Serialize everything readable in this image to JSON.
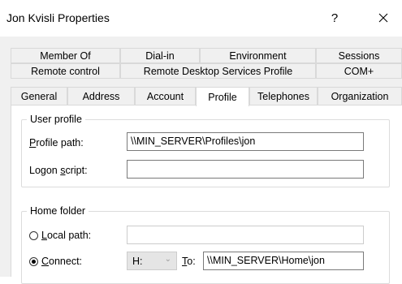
{
  "window": {
    "title": "Jon Kvisli Properties",
    "help_symbol": "?",
    "close_icon": "close-icon"
  },
  "tabs": {
    "row1": [
      "Member Of",
      "Dial-in",
      "Environment",
      "Sessions"
    ],
    "row2": [
      "Remote control",
      "Remote Desktop Services Profile",
      "COM+"
    ],
    "row3": [
      "General",
      "Address",
      "Account",
      "Profile",
      "Telephones",
      "Organization"
    ],
    "active": "Profile"
  },
  "user_profile": {
    "group_label": "User profile",
    "profile_path_label_accel": "P",
    "profile_path_label_rest": "rofile path:",
    "profile_path_value": "\\\\MIN_SERVER\\Profiles\\jon",
    "logon_script_label_pre": "Logon ",
    "logon_script_label_accel": "s",
    "logon_script_label_post": "cript:",
    "logon_script_value": ""
  },
  "home_folder": {
    "group_label": "Home folder",
    "local_path_label_accel": "L",
    "local_path_label_rest": "ocal path:",
    "local_path_value": "",
    "local_path_selected": false,
    "connect_label_accel": "C",
    "connect_label_rest": "onnect:",
    "connect_selected": true,
    "drive_value": "H:",
    "to_label_accel": "T",
    "to_label_rest": "o:",
    "to_value": "\\\\MIN_SERVER\\Home\\jon"
  }
}
